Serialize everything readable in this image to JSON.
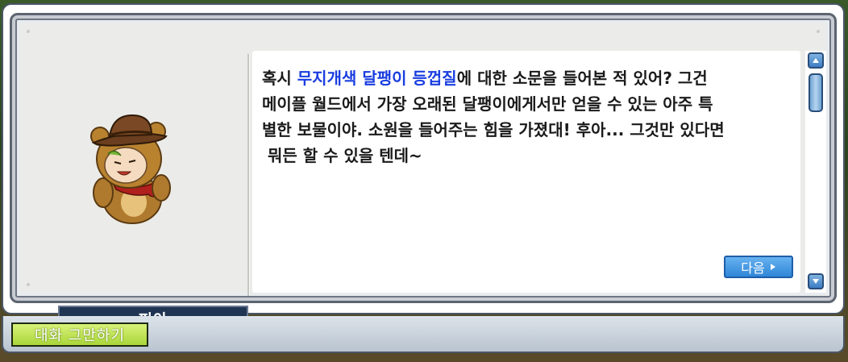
{
  "npc": {
    "name": "피아"
  },
  "dialog": {
    "text_line1_prefix": "혹시 ",
    "text_line1_highlight": "무지개색 달팽이 등껍질",
    "text_line1_suffix": "에 대한 소문을 들어본 적 있어? 그건",
    "text_line2": "메이플 월드에서 가장 오래된 달팽이에게서만 얻을 수 있는 아주 특",
    "text_line3": "별한 보물이야. 소원을 들어주는 힘을 가졌대! 후아... 그것만 있다면",
    "text_line4": " 뭐든 할 수 있을 텐데~",
    "highlight_color": "#1a3ee0",
    "next_button_label": "다음"
  },
  "bottom_bar": {
    "end_chat_label": "대화 그만하기"
  },
  "icons": {
    "next": "triangle-right-icon",
    "scroll_up": "arrow-up-icon",
    "scroll_down": "arrow-down-icon"
  }
}
